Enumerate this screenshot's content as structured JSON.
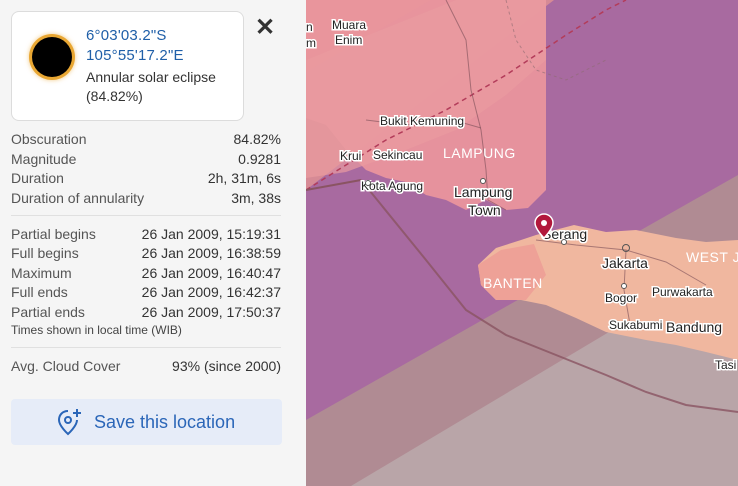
{
  "location": {
    "latitude": "6°03'03.2\"S",
    "longitude": "105°55'17.2\"E",
    "eclipse_type": "Annular solar eclipse",
    "eclipse_percent": "(84.82%)"
  },
  "close_label": "✕",
  "stats": [
    {
      "label": "Obscuration",
      "value": "84.82%"
    },
    {
      "label": "Magnitude",
      "value": "0.9281"
    },
    {
      "label": "Duration",
      "value": "2h, 31m, 6s"
    },
    {
      "label": "Duration of annularity",
      "value": "3m, 38s"
    }
  ],
  "times": [
    {
      "label": "Partial begins",
      "value": "26 Jan 2009, 15:19:31"
    },
    {
      "label": "Full begins",
      "value": "26 Jan 2009, 16:38:59"
    },
    {
      "label": "Maximum",
      "value": "26 Jan 2009, 16:40:47"
    },
    {
      "label": "Full ends",
      "value": "26 Jan 2009, 16:42:37"
    },
    {
      "label": "Partial ends",
      "value": "26 Jan 2009, 17:50:37"
    }
  ],
  "time_note": "Times shown in local time (WIB)",
  "cloud": {
    "label": "Avg. Cloud Cover",
    "value": "93% (since 2000)"
  },
  "save_button": {
    "label": "Save this location",
    "icon": "add-location-icon"
  },
  "map": {
    "labels": {
      "muara_enim": [
        "Muara",
        "Enim"
      ],
      "fragment_top": [
        "n",
        "m"
      ],
      "bukit_kemuning": "Bukit Kemuning",
      "krui": "Krui",
      "sekincau": "Sekincau",
      "lampung_region": "LAMPUNG",
      "kota_agung": "Kota Agung",
      "lampung_town": [
        "Lampung",
        "Town"
      ],
      "serang": "Serang",
      "banten": "BANTEN",
      "jakarta": "Jakarta",
      "west_ja": "WEST JA",
      "bogor": "Bogor",
      "purwakarta": "Purwakarta",
      "sukabumi": "Sukabumi",
      "bandung": "Bandung",
      "tasi": "Tasi"
    },
    "colors": {
      "annularity_band": "#a86aa0",
      "penumbra_inner": "#e58f93",
      "penumbra_outer": "#c8a09a",
      "land_tint": "#f0b79f",
      "marker": "#b2183b"
    }
  }
}
